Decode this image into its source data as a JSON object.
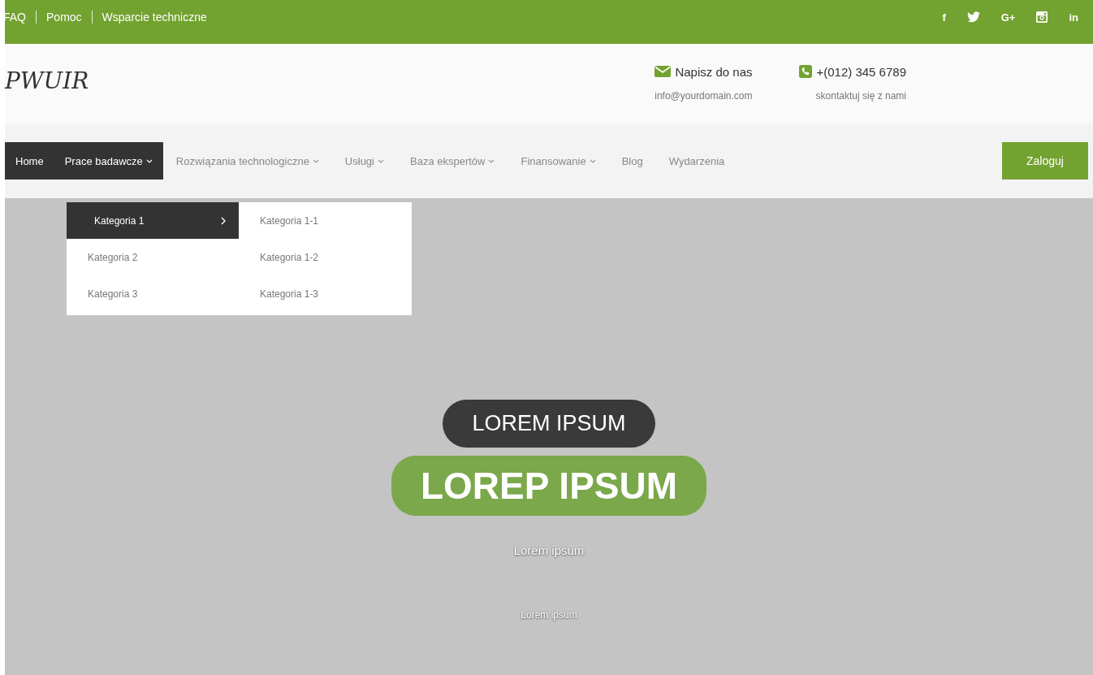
{
  "top_links": [
    "FAQ",
    "Pomoc",
    "Wsparcie techniczne"
  ],
  "social": [
    {
      "kind": "glyph",
      "label": "f"
    },
    {
      "kind": "bird"
    },
    {
      "kind": "glyph",
      "label": "G+"
    },
    {
      "kind": "camera"
    },
    {
      "kind": "glyph",
      "label": "in"
    }
  ],
  "logo": "PWUIR",
  "contacts": [
    {
      "kind": "mail",
      "title": "Napisz do nas",
      "subtitle": "info@yourdomain.com"
    },
    {
      "kind": "phone",
      "title": "+(012) 345 6789",
      "subtitle": "skontaktuj się z nami"
    }
  ],
  "nav": [
    {
      "label": "Home",
      "selected": true,
      "dropdown": false,
      "expanded": false
    },
    {
      "label": "Prace badawcze",
      "selected": true,
      "dropdown": true,
      "expanded": true,
      "menu": [
        {
          "label": "Kategoria 1",
          "selected": true,
          "children": [
            {
              "label": "Kategoria 1-1"
            },
            {
              "label": "Kategoria 1-2"
            },
            {
              "label": "Kategoria 1-3"
            }
          ]
        },
        {
          "label": "Kategoria 2",
          "selected": false
        },
        {
          "label": "Kategoria 3",
          "selected": false
        }
      ]
    },
    {
      "label": "Rozwiązania technologiczne",
      "selected": false,
      "dropdown": true,
      "expanded": false
    },
    {
      "label": "Usługi",
      "selected": false,
      "dropdown": true,
      "expanded": false
    },
    {
      "label": "Baza ekspertów",
      "selected": false,
      "dropdown": true,
      "expanded": false
    },
    {
      "label": "Finansowanie",
      "selected": false,
      "dropdown": true,
      "expanded": false
    },
    {
      "label": "Blog",
      "selected": false,
      "dropdown": false,
      "expanded": false
    },
    {
      "label": "Wydarzenia",
      "selected": false,
      "dropdown": false,
      "expanded": false
    }
  ],
  "login_button": "Zaloguj",
  "hero": {
    "kicker": "LOREM IPSUM",
    "headline": "LOREP IPSUM",
    "lines": [
      "Lorem ipsum",
      "Lorem ipsum"
    ]
  }
}
